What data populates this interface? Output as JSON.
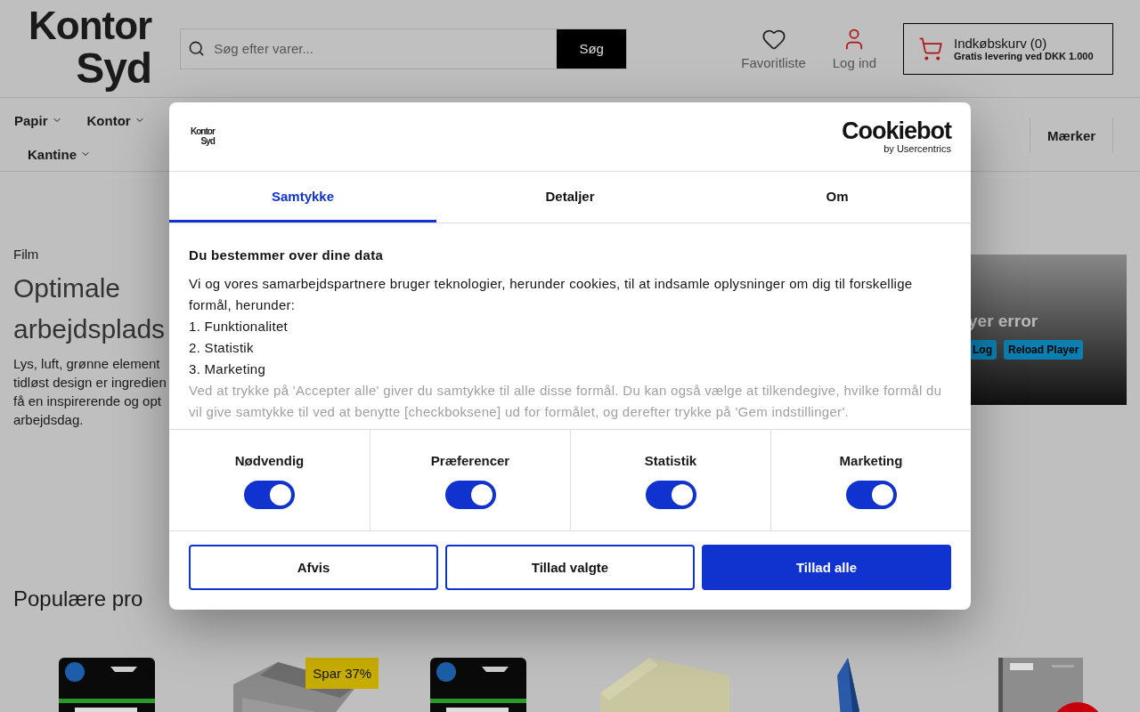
{
  "header": {
    "logo": [
      "Kontor",
      "Syd"
    ],
    "search": {
      "placeholder": "Søg efter varer...",
      "button": "Søg"
    },
    "actions": [
      {
        "kind": "favorites",
        "label": "Favoritliste"
      },
      {
        "kind": "login",
        "label": "Log ind"
      }
    ],
    "cart": {
      "title": "Indkøbskurv (0)",
      "note": "Gratis levering ved DKK 1.000"
    }
  },
  "nav": {
    "rows": [
      [
        "Papir",
        "Kontor"
      ],
      [
        "Kantine"
      ]
    ],
    "brands": "Mærker"
  },
  "hero": {
    "eyebrow": "Film",
    "title": [
      "Optimale",
      "arbejdsplads"
    ],
    "text": [
      "Lys, luft, grønne element",
      "tidløst design er ingredien",
      "få en inspirerende og opt",
      "arbejdsdag."
    ],
    "player": {
      "error": "yer error",
      "buttons": [
        "Log",
        "Reload Player"
      ]
    }
  },
  "popular": {
    "title": "Populære pro",
    "products": [
      {
        "kind": "ink"
      },
      {
        "kind": "paper",
        "badge": "Spar 37%"
      },
      {
        "kind": "ink"
      },
      {
        "kind": "notes"
      },
      {
        "kind": "flag"
      },
      {
        "kind": "notebook"
      }
    ]
  },
  "dialog": {
    "logo": [
      "Kontor",
      "Syd"
    ],
    "brand": "Cookiebot",
    "brand_sub": "by Usercentrics",
    "tabs": [
      {
        "label": "Samtykke",
        "selected": true
      },
      {
        "label": "Detaljer",
        "selected": false
      },
      {
        "label": "Om",
        "selected": false
      }
    ],
    "heading": "Du bestemmer over dine data",
    "intro": "Vi og vores samarbejdspartnere bruger teknologier, herunder cookies, til at indsamle oplysninger om dig til forskellige formål, herunder:",
    "list": [
      "1. Funktionalitet",
      "2. Statistik",
      "3. Marketing"
    ],
    "faded": "Ved at trykke på 'Accepter alle' giver du samtykke til alle disse formål. Du kan også vælge at tilkendegive, hvilke formål du vil give samtykke til ved at benytte [checkboksene] ud for formålet, og derefter trykke på 'Gem indstillinger'.",
    "categories": [
      {
        "label": "Nødvendig",
        "checked": true
      },
      {
        "label": "Præferencer",
        "checked": true
      },
      {
        "label": "Statistik",
        "checked": true
      },
      {
        "label": "Marketing",
        "checked": true
      }
    ],
    "buttons": [
      {
        "label": "Afvis",
        "kind": "outline"
      },
      {
        "label": "Tillad valgte",
        "kind": "outline"
      },
      {
        "label": "Tillad alle",
        "kind": "primary"
      }
    ]
  }
}
